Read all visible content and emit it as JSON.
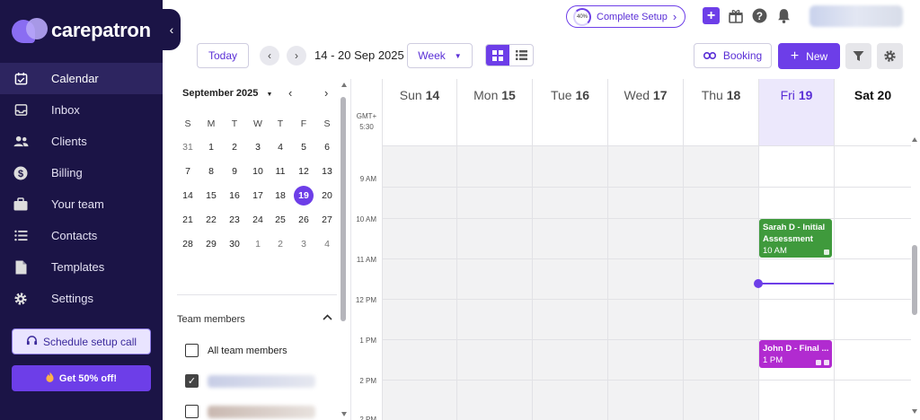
{
  "brand": {
    "name": "carepatron",
    "accent": "#6d3ee8",
    "sidebar_bg": "#1b1446"
  },
  "sidebar": {
    "items": [
      {
        "label": "Calendar",
        "icon": "calendar-icon",
        "active": true
      },
      {
        "label": "Inbox",
        "icon": "inbox-icon",
        "active": false
      },
      {
        "label": "Clients",
        "icon": "clients-icon",
        "active": false
      },
      {
        "label": "Billing",
        "icon": "dollar-icon",
        "active": false
      },
      {
        "label": "Your team",
        "icon": "briefcase-icon",
        "active": false
      },
      {
        "label": "Contacts",
        "icon": "list-icon",
        "active": false
      },
      {
        "label": "Templates",
        "icon": "document-icon",
        "active": false
      },
      {
        "label": "Settings",
        "icon": "gear-icon",
        "active": false
      }
    ],
    "setup_call_label": "Schedule setup call",
    "discount_label": "Get 50% off!"
  },
  "topbar": {
    "complete_setup_label": "Complete Setup",
    "complete_setup_progress": "40%",
    "icons": [
      "plus-icon",
      "gift-icon",
      "help-icon",
      "bell-icon"
    ]
  },
  "toolbar": {
    "today_label": "Today",
    "date_range": "14 - 20 Sep 2025",
    "view_select": "Week",
    "booking_label": "Booking",
    "new_label": "New"
  },
  "mini_calendar": {
    "month_label": "September 2025",
    "weekdays": [
      "S",
      "M",
      "T",
      "W",
      "T",
      "F",
      "S"
    ],
    "weeks": [
      [
        "31",
        "1",
        "2",
        "3",
        "4",
        "5",
        "6"
      ],
      [
        "7",
        "8",
        "9",
        "10",
        "11",
        "12",
        "13"
      ],
      [
        "14",
        "15",
        "16",
        "17",
        "18",
        "19",
        "20"
      ],
      [
        "21",
        "22",
        "23",
        "24",
        "25",
        "26",
        "27"
      ],
      [
        "28",
        "29",
        "30",
        "1",
        "2",
        "3",
        "4"
      ]
    ],
    "selected_day": "19"
  },
  "team": {
    "heading": "Team members",
    "all_label": "All team members"
  },
  "calendar": {
    "timezone_line1": "GMT+",
    "timezone_line2": "5:30",
    "days": [
      {
        "name": "Sun",
        "num": "14"
      },
      {
        "name": "Mon",
        "num": "15"
      },
      {
        "name": "Tue",
        "num": "16"
      },
      {
        "name": "Wed",
        "num": "17"
      },
      {
        "name": "Thu",
        "num": "18"
      },
      {
        "name": "Fri",
        "num": "19"
      },
      {
        "name": "Sat",
        "num": "20"
      }
    ],
    "times": [
      "9 AM",
      "10 AM",
      "11 AM",
      "12 PM",
      "1 PM",
      "2 PM"
    ],
    "events": [
      {
        "title": "Sarah D - Initial Assessment",
        "time": "10 AM",
        "color": "#3f9a3c"
      },
      {
        "title": "John D - Final ...",
        "time": "1 PM",
        "color": "#b12bd0"
      }
    ]
  }
}
